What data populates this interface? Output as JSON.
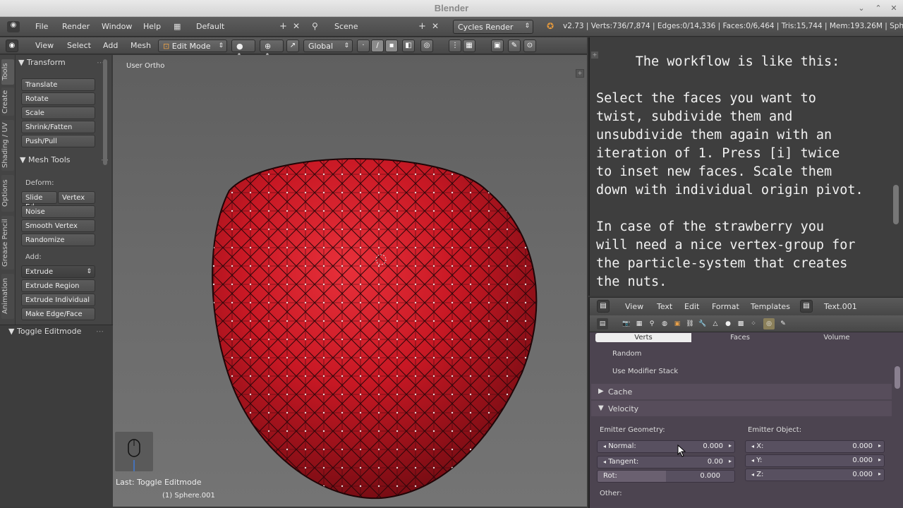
{
  "window": {
    "title": "Blender"
  },
  "info_header": {
    "menus": [
      "File",
      "Render",
      "Window",
      "Help"
    ],
    "screen_layout": "Default",
    "scene": "Scene",
    "render_engine": "Cycles Render",
    "stats": "v2.73 | Verts:736/7,874 | Edges:0/14,336 | Faces:0/6,464 | Tris:15,744 | Mem:193.26M | Sphe"
  },
  "view3d_header": {
    "menus": [
      "View",
      "Select",
      "Add",
      "Mesh"
    ],
    "mode": "Edit Mode",
    "orientation": "Global"
  },
  "tool_tabs": [
    "Tools",
    "Create",
    "Shading / UV",
    "Options",
    "Grease Pencil",
    "Animation"
  ],
  "tool_shelf": {
    "transform_header": "Transform",
    "transform_buttons": [
      "Translate",
      "Rotate",
      "Scale",
      "Shrink/Fatten",
      "Push/Pull"
    ],
    "mesh_tools_header": "Mesh Tools",
    "deform_label": "Deform:",
    "slide_edge": "Slide Ed",
    "vertex": "Vertex",
    "noise": "Noise",
    "smooth_vertex": "Smooth Vertex",
    "randomize": "Randomize",
    "add_label": "Add:",
    "extrude_select": "Extrude",
    "extrude_region": "Extrude Region",
    "extrude_individual": "Extrude Individual",
    "make_edge_face": "Make Edge/Face",
    "last_operator_panel": "Toggle Editmode"
  },
  "viewport": {
    "view_label": "User Ortho",
    "last_op_overlay": "Last: Toggle Editmode",
    "object_label": "(1) Sphere.001"
  },
  "text_editor": {
    "content": "     The workflow is like this:\n\nSelect the faces you want to\ntwist, subdivide them and\nunsubdivide them again with an\niteration of 1. Press [i] twice\nto inset new faces. Scale them\ndown with individual origin pivot.\n\nIn case of the strawberry you\nwill need a nice vertex-group for\nthe particle-system that creates\nthe nuts.",
    "menus": [
      "View",
      "Text",
      "Edit",
      "Format",
      "Templates"
    ],
    "datablock": "Text.001"
  },
  "properties": {
    "tabs": [
      "Verts",
      "Faces",
      "Volume"
    ],
    "random_label": "Random",
    "use_modifier_stack": "Use Modifier Stack",
    "cache_header": "Cache",
    "velocity_header": "Velocity",
    "emitter_geometry": "Emitter Geometry:",
    "emitter_object": "Emitter Object:",
    "normal_label": "Normal:",
    "normal_value": "0.000",
    "tangent_label": "Tangent:",
    "tangent_value": "0.00",
    "rot_label": "Rot:",
    "rot_value": "0.000",
    "x_label": "X:",
    "x_value": "0.000",
    "y_label": "Y:",
    "y_value": "0.000",
    "z_label": "Z:",
    "z_value": "0.000",
    "other_label": "Other:"
  }
}
